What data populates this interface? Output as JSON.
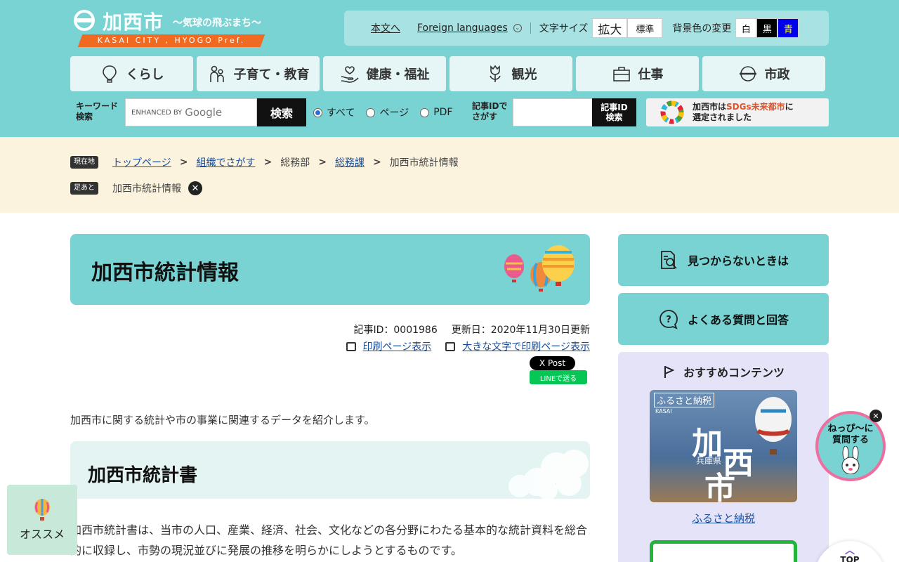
{
  "header": {
    "logo_title": "加西市",
    "logo_sub": "～気球の飛ぶまち～",
    "logo_band": "KASAI CITY , HYOGO Pref.",
    "utility": {
      "main_text_link": "本文へ",
      "foreign_languages": "Foreign languages",
      "font_size_label": "文字サイズ",
      "font_big": "拡大",
      "font_std": "標準",
      "bg_label": "背景色の変更",
      "bg_white": "白",
      "bg_black": "黒",
      "bg_blue": "青"
    },
    "nav": [
      {
        "label": "くらし",
        "icon": "balloon-icon"
      },
      {
        "label": "子育て・教育",
        "icon": "family-icon"
      },
      {
        "label": "健康・福祉",
        "icon": "hand-heart-icon"
      },
      {
        "label": "観光",
        "icon": "tulip-icon"
      },
      {
        "label": "仕事",
        "icon": "briefcase-icon"
      },
      {
        "label": "市政",
        "icon": "city-mark-icon"
      }
    ],
    "search": {
      "keyword_label_1": "キーワード",
      "keyword_label_2": "検索",
      "enhanced_by": "ENHANCED BY",
      "google": "Google",
      "button": "検索",
      "radio_all": "すべて",
      "radio_page": "ページ",
      "radio_pdf": "PDF",
      "id_label_1": "記事IDで",
      "id_label_2": "さがす",
      "id_button_1": "記事ID",
      "id_button_2": "検索"
    },
    "sdgs": {
      "line1_a": "加西市は",
      "line1_b": "SDGs未来都市",
      "line1_c": "に",
      "line2": "選定されました"
    }
  },
  "breadcrumb": {
    "current_tag": "現在地",
    "items": [
      "トップページ",
      "組織でさがす",
      "総務部",
      "総務課",
      "加西市統計情報"
    ],
    "history_tag": "足あと",
    "history_item": "加西市統計情報"
  },
  "main": {
    "title": "加西市統計情報",
    "article_id": "記事ID：0001986",
    "updated": "更新日：2020年11月30日更新",
    "print_link": "印刷ページ表示",
    "print_large_link": "大きな文字で印刷ページ表示",
    "x_post": "X Post",
    "line_send": "LINEで送る",
    "intro": "加西市に関する統計や市の事業に関連するデータを紹介します。",
    "section_title": "加西市統計書",
    "section_body": "加西市統計書は、当市の人口、産業、経済、社会、文化などの各分野にわたる基本的な統計資料を総合的に収録し、市勢の現況並びに発展の推移を明らかにしようとするものです。"
  },
  "sidebar": {
    "not_found": "見つからないときは",
    "faq": "よくある質問と回答",
    "recommend_title": "おすすめコンテンツ",
    "furusato_tag": "ふるさと納税",
    "furusato_kasai": "KASAI",
    "furusato_pref": "兵庫県",
    "furusato_big1": "加",
    "furusato_big2": "西",
    "furusato_big3": "市",
    "furusato_link": "ふるさと納税"
  },
  "floating": {
    "osusume": "オススメ",
    "chara_line1": "ねっぴ～に",
    "chara_line2": "質問する",
    "top": "TOP"
  },
  "colors": {
    "header_bg": "#79d3d3",
    "accent_orange": "#f06a22",
    "crumb_bg": "#fbf3dd",
    "link": "#1a4e9c"
  }
}
